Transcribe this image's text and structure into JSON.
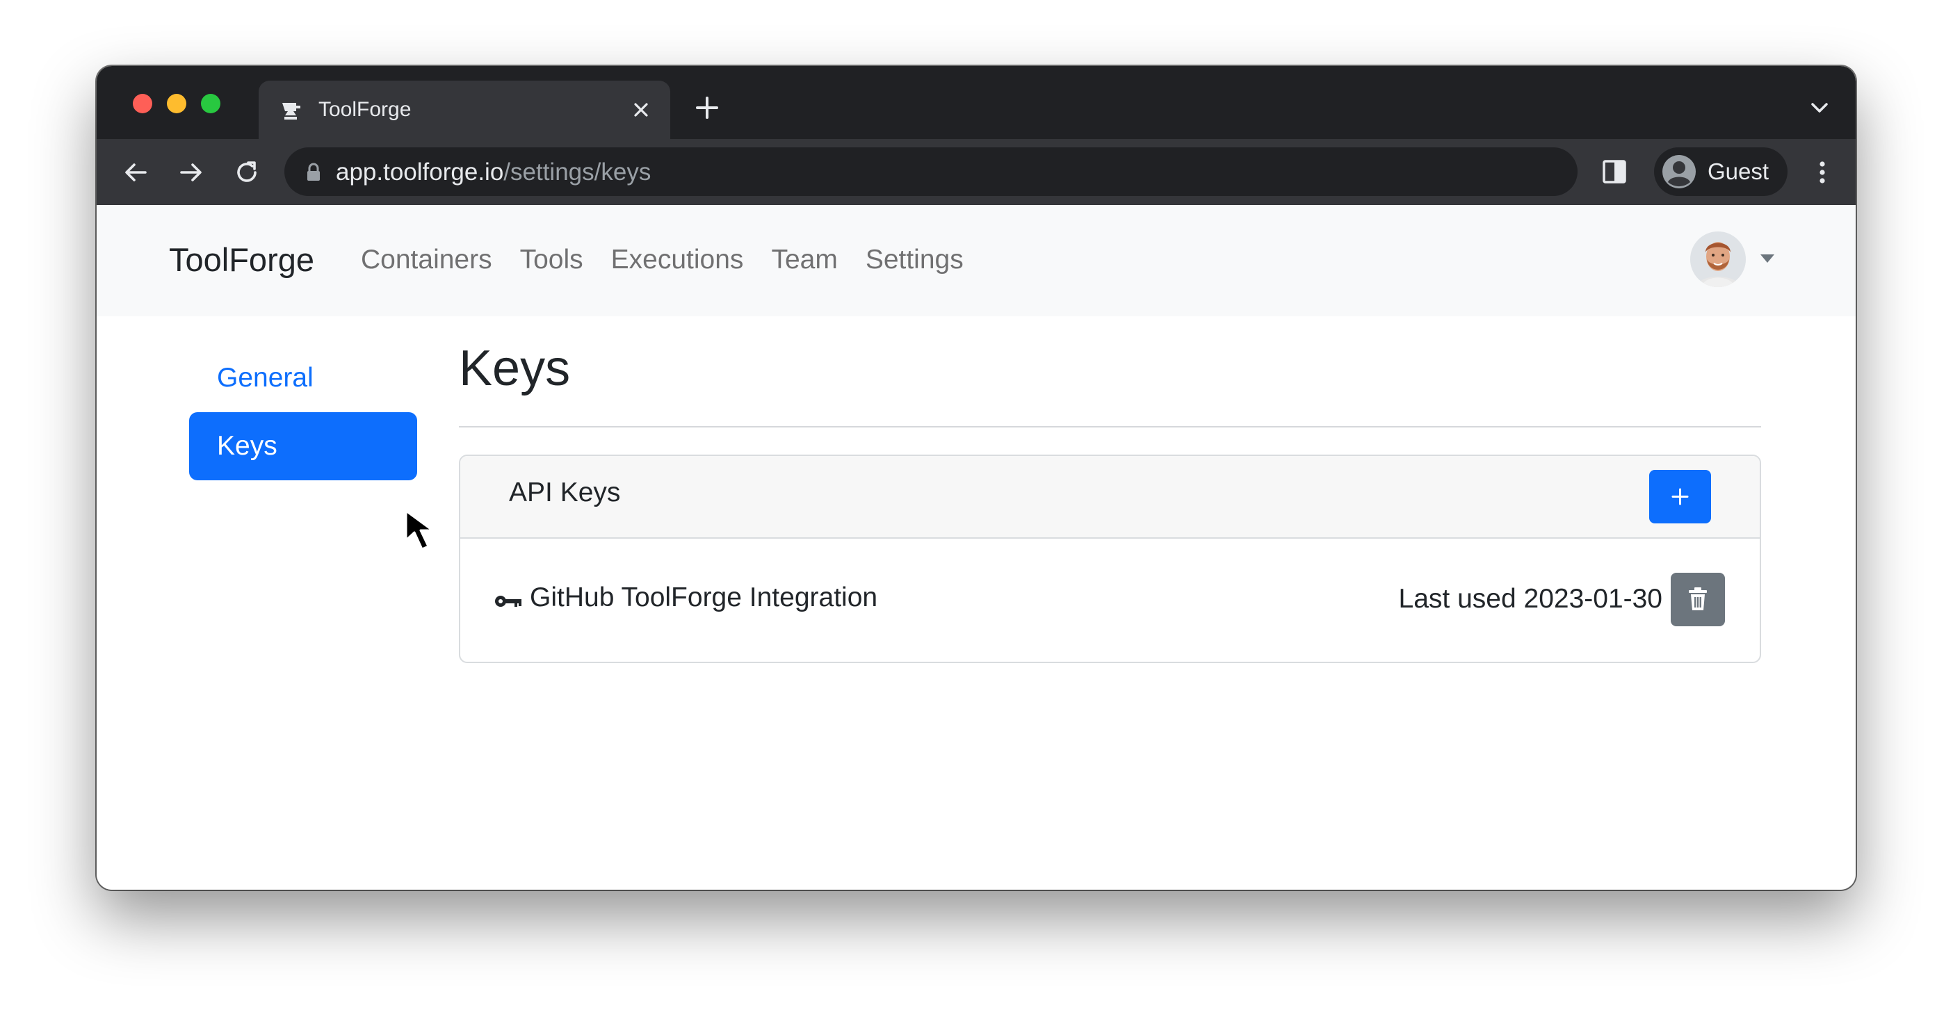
{
  "browser": {
    "tab_title": "ToolForge",
    "url_host": "app.toolforge.io",
    "url_path": "/settings/keys",
    "profile_label": "Guest"
  },
  "app": {
    "brand": "ToolForge",
    "nav_links": [
      "Containers",
      "Tools",
      "Executions",
      "Team",
      "Settings"
    ]
  },
  "sidebar": {
    "items": [
      {
        "label": "General",
        "active": false
      },
      {
        "label": "Keys",
        "active": true
      }
    ]
  },
  "main": {
    "title": "Keys",
    "card": {
      "title": "API Keys",
      "add_label": "+",
      "keys": [
        {
          "name": "GitHub ToolForge Integration",
          "last_used": "Last used 2023-01-30"
        }
      ]
    }
  },
  "colors": {
    "primary": "#0d6efd",
    "secondary": "#6c757d",
    "navbar_bg": "#f8f9fa",
    "chrome_dark": "#202124",
    "chrome_toolbar": "#35363a"
  },
  "icons": {
    "tab_favicon": "anvil-icon",
    "key": "key-icon",
    "delete": "trash-icon",
    "add": "plus-icon"
  }
}
